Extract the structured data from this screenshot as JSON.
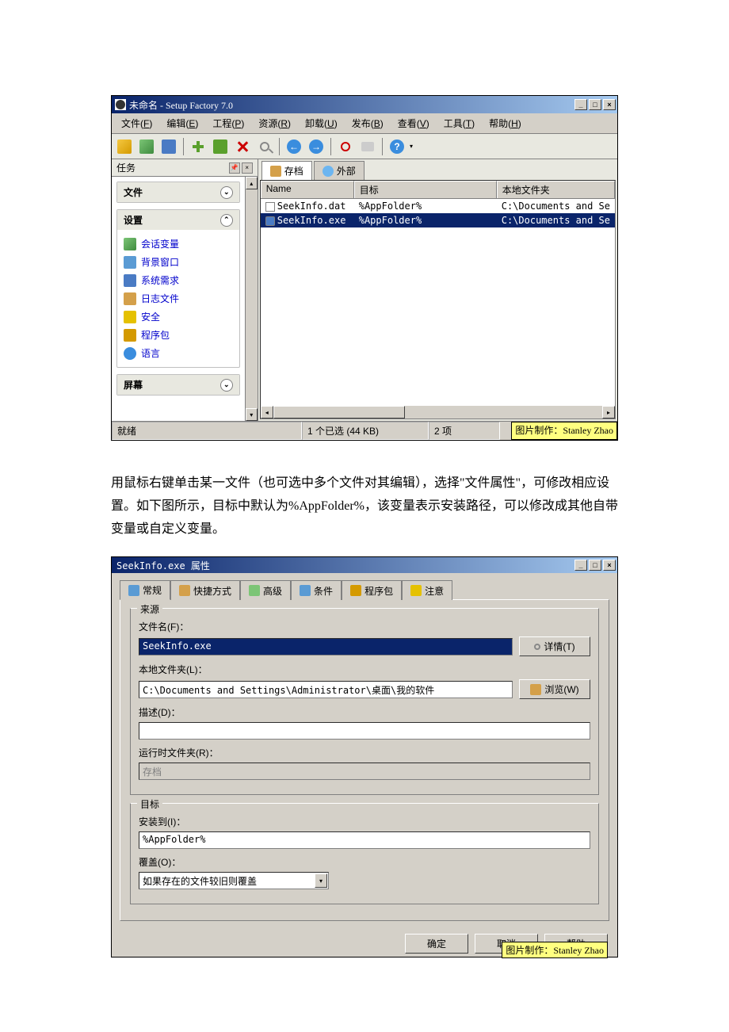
{
  "window1": {
    "title": "未命名 - Setup Factory 7.0",
    "menubar": [
      {
        "label": "文件",
        "accel": "F"
      },
      {
        "label": "编辑",
        "accel": "E"
      },
      {
        "label": "工程",
        "accel": "P"
      },
      {
        "label": "资源",
        "accel": "R"
      },
      {
        "label": "卸载",
        "accel": "U"
      },
      {
        "label": "发布",
        "accel": "B"
      },
      {
        "label": "查看",
        "accel": "V"
      },
      {
        "label": "工具",
        "accel": "T"
      },
      {
        "label": "帮助",
        "accel": "H"
      }
    ],
    "sidebar": {
      "header": "任务",
      "blocks": [
        {
          "title": "文件",
          "expanded": false,
          "items": []
        },
        {
          "title": "设置",
          "expanded": true,
          "items": [
            "会话变量",
            "背景窗口",
            "系统需求",
            "日志文件",
            "安全",
            "程序包",
            "语言"
          ]
        },
        {
          "title": "屏幕",
          "expanded": false,
          "items": []
        }
      ]
    },
    "tabs": [
      "存档",
      "外部"
    ],
    "columns": [
      "Name",
      "目标",
      "本地文件夹"
    ],
    "rows": [
      {
        "name": "SeekInfo.dat",
        "target": "%AppFolder%",
        "local": "C:\\Documents and Se",
        "selected": false
      },
      {
        "name": "SeekInfo.exe",
        "target": "%AppFolder%",
        "local": "C:\\Documents and Se",
        "selected": true
      }
    ],
    "status": {
      "ready": "就绪",
      "selection": "1 个已选 (44 KB)",
      "count": "2 项",
      "credit": "图片制作：Stanley Zhao"
    }
  },
  "doc_text": "用鼠标右键单击某一文件（也可选中多个文件对其编辑），选择\"文件属性\"，可修改相应设置。如下图所示，目标中默认为%AppFolder%，该变量表示安装路径，可以修改成其他自带变量或自定义变量。",
  "dialog": {
    "title": "SeekInfo.exe 属性",
    "tabs": [
      "常规",
      "快捷方式",
      "高级",
      "条件",
      "程序包",
      "注意"
    ],
    "source": {
      "legend": "来源",
      "filename_label": "文件名(F)：",
      "filename_value": "SeekInfo.exe",
      "details_btn": "详情(T)",
      "localfolder_label": "本地文件夹(L)：",
      "localfolder_value": "C:\\Documents and Settings\\Administrator\\桌面\\我的软件",
      "browse_btn": "浏览(W)",
      "desc_label": "描述(D)：",
      "desc_value": "",
      "runtime_label": "运行时文件夹(R)：",
      "runtime_value": "存档"
    },
    "target": {
      "legend": "目标",
      "install_label": "安装到(I)：",
      "install_value": "%AppFolder%",
      "overwrite_label": "覆盖(O)：",
      "overwrite_value": "如果存在的文件较旧则覆盖"
    },
    "buttons": {
      "ok": "确定",
      "cancel": "取消",
      "help": "帮助"
    },
    "credit": "图片制作：Stanley Zhao"
  }
}
